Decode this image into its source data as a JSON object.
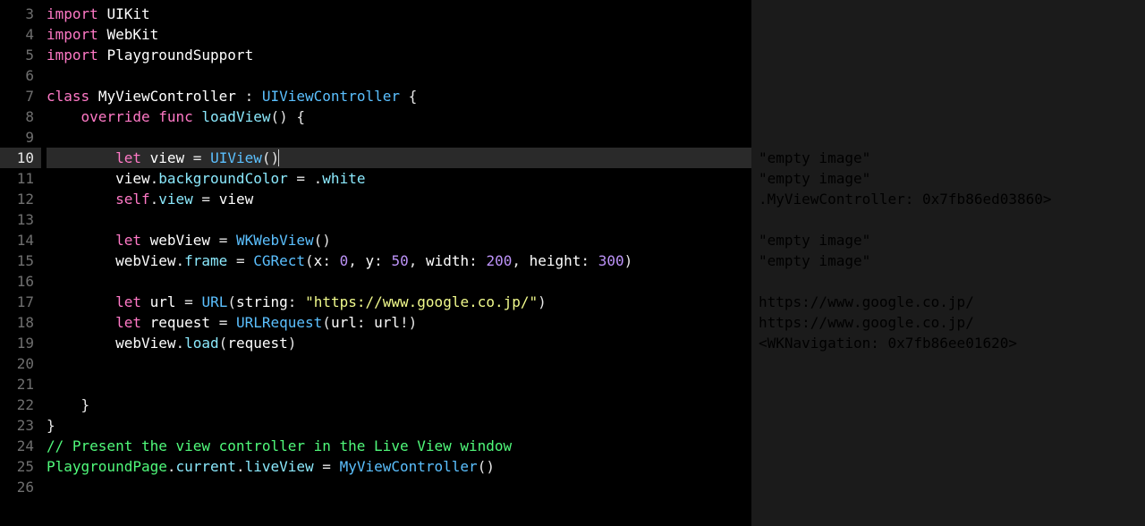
{
  "editor": {
    "highlighted_line": 10,
    "lines": [
      {
        "n": 3,
        "tokens": [
          [
            "kw",
            "import"
          ],
          [
            "plain",
            " "
          ],
          [
            "id",
            "UIKit"
          ]
        ]
      },
      {
        "n": 4,
        "tokens": [
          [
            "kw",
            "import"
          ],
          [
            "plain",
            " "
          ],
          [
            "id",
            "WebKit"
          ]
        ]
      },
      {
        "n": 5,
        "tokens": [
          [
            "kw",
            "import"
          ],
          [
            "plain",
            " "
          ],
          [
            "id",
            "PlaygroundSupport"
          ]
        ]
      },
      {
        "n": 6,
        "tokens": []
      },
      {
        "n": 7,
        "tokens": [
          [
            "kw",
            "class"
          ],
          [
            "plain",
            " "
          ],
          [
            "id",
            "MyViewController"
          ],
          [
            "plain",
            " "
          ],
          [
            "punct",
            ":"
          ],
          [
            "plain",
            " "
          ],
          [
            "type",
            "UIViewController"
          ],
          [
            "plain",
            " "
          ],
          [
            "punct",
            "{"
          ]
        ]
      },
      {
        "n": 8,
        "tokens": [
          [
            "plain",
            "    "
          ],
          [
            "kw",
            "override"
          ],
          [
            "plain",
            " "
          ],
          [
            "kw",
            "func"
          ],
          [
            "plain",
            " "
          ],
          [
            "fn",
            "loadView"
          ],
          [
            "punct",
            "()"
          ],
          [
            "plain",
            " "
          ],
          [
            "punct",
            "{"
          ]
        ]
      },
      {
        "n": 9,
        "tokens": []
      },
      {
        "n": 10,
        "cursor": true,
        "tokens": [
          [
            "plain",
            "        "
          ],
          [
            "kw",
            "let"
          ],
          [
            "plain",
            " "
          ],
          [
            "id",
            "view"
          ],
          [
            "plain",
            " "
          ],
          [
            "punct",
            "="
          ],
          [
            "plain",
            " "
          ],
          [
            "type",
            "UIView"
          ],
          [
            "punct",
            "()"
          ]
        ]
      },
      {
        "n": 11,
        "tokens": [
          [
            "plain",
            "        "
          ],
          [
            "id",
            "view"
          ],
          [
            "punct",
            "."
          ],
          [
            "prop",
            "backgroundColor"
          ],
          [
            "plain",
            " "
          ],
          [
            "punct",
            "="
          ],
          [
            "plain",
            " "
          ],
          [
            "punct",
            "."
          ],
          [
            "enum",
            "white"
          ]
        ]
      },
      {
        "n": 12,
        "tokens": [
          [
            "plain",
            "        "
          ],
          [
            "kw",
            "self"
          ],
          [
            "punct",
            "."
          ],
          [
            "prop",
            "view"
          ],
          [
            "plain",
            " "
          ],
          [
            "punct",
            "="
          ],
          [
            "plain",
            " "
          ],
          [
            "id",
            "view"
          ]
        ]
      },
      {
        "n": 13,
        "tokens": []
      },
      {
        "n": 14,
        "tokens": [
          [
            "plain",
            "        "
          ],
          [
            "kw",
            "let"
          ],
          [
            "plain",
            " "
          ],
          [
            "id",
            "webView"
          ],
          [
            "plain",
            " "
          ],
          [
            "punct",
            "="
          ],
          [
            "plain",
            " "
          ],
          [
            "type",
            "WKWebView"
          ],
          [
            "punct",
            "()"
          ]
        ]
      },
      {
        "n": 15,
        "tokens": [
          [
            "plain",
            "        "
          ],
          [
            "id",
            "webView"
          ],
          [
            "punct",
            "."
          ],
          [
            "prop",
            "frame"
          ],
          [
            "plain",
            " "
          ],
          [
            "punct",
            "="
          ],
          [
            "plain",
            " "
          ],
          [
            "type",
            "CGRect"
          ],
          [
            "punct",
            "("
          ],
          [
            "id",
            "x"
          ],
          [
            "punct",
            ":"
          ],
          [
            "plain",
            " "
          ],
          [
            "num",
            "0"
          ],
          [
            "punct",
            ","
          ],
          [
            "plain",
            " "
          ],
          [
            "id",
            "y"
          ],
          [
            "punct",
            ":"
          ],
          [
            "plain",
            " "
          ],
          [
            "num",
            "50"
          ],
          [
            "punct",
            ","
          ],
          [
            "plain",
            " "
          ],
          [
            "id",
            "width"
          ],
          [
            "punct",
            ":"
          ],
          [
            "plain",
            " "
          ],
          [
            "num",
            "200"
          ],
          [
            "punct",
            ","
          ],
          [
            "plain",
            " "
          ],
          [
            "id",
            "height"
          ],
          [
            "punct",
            ":"
          ],
          [
            "plain",
            " "
          ],
          [
            "num",
            "300"
          ],
          [
            "punct",
            ")"
          ]
        ]
      },
      {
        "n": 16,
        "tokens": []
      },
      {
        "n": 17,
        "tokens": [
          [
            "plain",
            "        "
          ],
          [
            "kw",
            "let"
          ],
          [
            "plain",
            " "
          ],
          [
            "id",
            "url"
          ],
          [
            "plain",
            " "
          ],
          [
            "punct",
            "="
          ],
          [
            "plain",
            " "
          ],
          [
            "type",
            "URL"
          ],
          [
            "punct",
            "("
          ],
          [
            "id",
            "string"
          ],
          [
            "punct",
            ":"
          ],
          [
            "plain",
            " "
          ],
          [
            "str",
            "\"https://www.google.co.jp/\""
          ],
          [
            "punct",
            ")"
          ]
        ]
      },
      {
        "n": 18,
        "tokens": [
          [
            "plain",
            "        "
          ],
          [
            "kw",
            "let"
          ],
          [
            "plain",
            " "
          ],
          [
            "id",
            "request"
          ],
          [
            "plain",
            " "
          ],
          [
            "punct",
            "="
          ],
          [
            "plain",
            " "
          ],
          [
            "type",
            "URLRequest"
          ],
          [
            "punct",
            "("
          ],
          [
            "id",
            "url"
          ],
          [
            "punct",
            ":"
          ],
          [
            "plain",
            " "
          ],
          [
            "id",
            "url"
          ],
          [
            "punct",
            "!)"
          ]
        ]
      },
      {
        "n": 19,
        "tokens": [
          [
            "plain",
            "        "
          ],
          [
            "id",
            "webView"
          ],
          [
            "punct",
            "."
          ],
          [
            "prop",
            "load"
          ],
          [
            "punct",
            "("
          ],
          [
            "id",
            "request"
          ],
          [
            "punct",
            ")"
          ]
        ]
      },
      {
        "n": 20,
        "tokens": []
      },
      {
        "n": 21,
        "tokens": []
      },
      {
        "n": 22,
        "tokens": [
          [
            "plain",
            "    "
          ],
          [
            "punct",
            "}"
          ]
        ]
      },
      {
        "n": 23,
        "tokens": [
          [
            "punct",
            "}"
          ]
        ]
      },
      {
        "n": 24,
        "tokens": [
          [
            "cmt",
            "// Present the view controller in the Live View window"
          ]
        ]
      },
      {
        "n": 25,
        "tokens": [
          [
            "id2",
            "PlaygroundPage"
          ],
          [
            "punct",
            "."
          ],
          [
            "prop",
            "current"
          ],
          [
            "punct",
            "."
          ],
          [
            "prop",
            "liveView"
          ],
          [
            "plain",
            " "
          ],
          [
            "punct",
            "="
          ],
          [
            "plain",
            " "
          ],
          [
            "type",
            "MyViewController"
          ],
          [
            "punct",
            "()"
          ]
        ]
      },
      {
        "n": 26,
        "tokens": []
      }
    ]
  },
  "results": {
    "rows": [
      {
        "line": 10,
        "text": "\"empty image\""
      },
      {
        "line": 11,
        "text": "\"empty image\""
      },
      {
        "line": 12,
        "text": ".MyViewController: 0x7fb86ed03860>"
      },
      {
        "line": 13,
        "text": ""
      },
      {
        "line": 14,
        "text": "\"empty image\""
      },
      {
        "line": 15,
        "text": "\"empty image\""
      },
      {
        "line": 16,
        "text": ""
      },
      {
        "line": 17,
        "text": "https://www.google.co.jp/"
      },
      {
        "line": 18,
        "text": "https://www.google.co.jp/"
      },
      {
        "line": 19,
        "text": "<WKNavigation: 0x7fb86ee01620>"
      }
    ]
  }
}
